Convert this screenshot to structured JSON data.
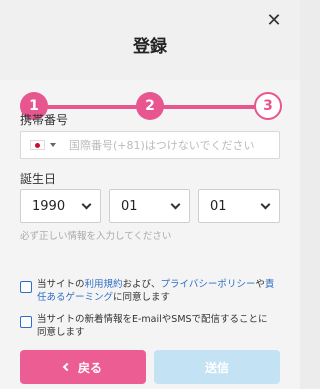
{
  "modal": {
    "title": "登録",
    "close_icon": "close-icon"
  },
  "progress": {
    "steps": [
      {
        "label": "1",
        "state": "active"
      },
      {
        "label": "2",
        "state": "active"
      },
      {
        "label": "3",
        "state": "todo"
      }
    ],
    "accent_color": "#e8568f"
  },
  "phone": {
    "label": "携帯番号",
    "placeholder": "国際番号(+81)はつけないでください",
    "country_icon": "japan-flag-icon"
  },
  "dob": {
    "label": "誕生日",
    "year": "1990",
    "month": "01",
    "day": "01",
    "hint": "必ず正しい情報を入力してください"
  },
  "consent": {
    "terms_prefix": "当サイトの",
    "terms_link": "利用規約",
    "terms_mid": "および、",
    "privacy_link": "プライバシーポリシー",
    "terms_mid2": "や",
    "responsible_link": "責任あるゲーミング",
    "terms_suffix": "に同意します",
    "newsletter": "当サイトの新着情報をE-mailやSMSで配信することに同意します"
  },
  "buttons": {
    "back": "戻る",
    "submit": "送信"
  }
}
